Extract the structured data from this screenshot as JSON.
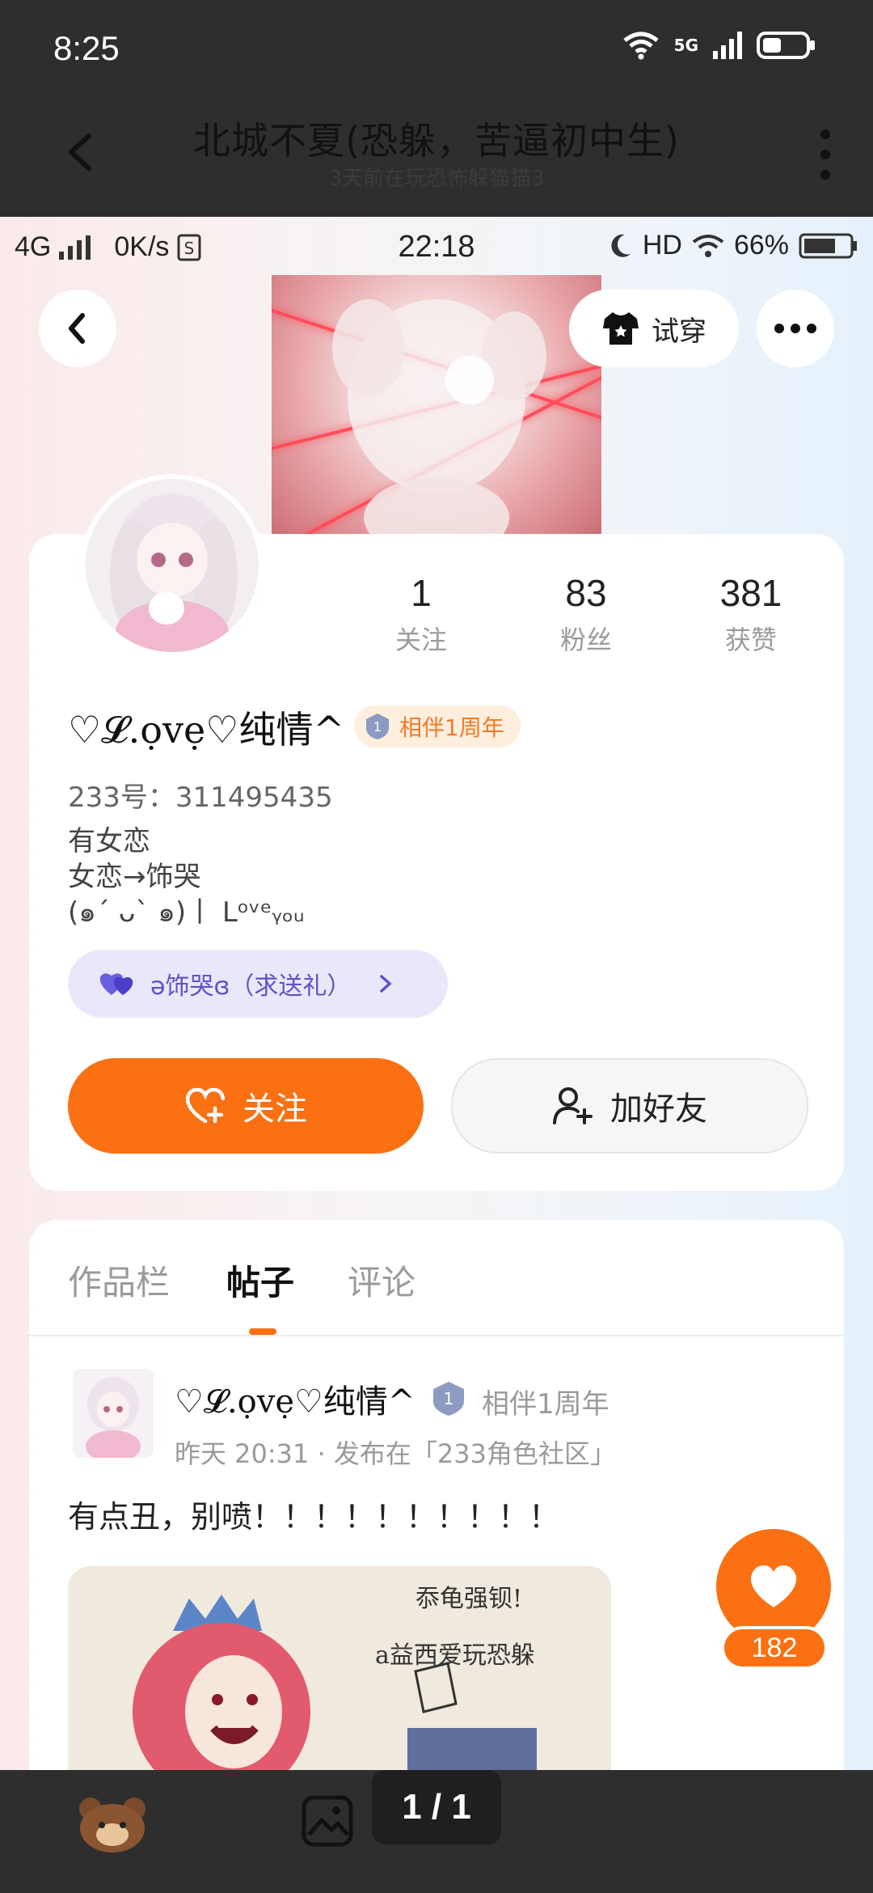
{
  "outer": {
    "time": "8:25",
    "network": "5G",
    "title": "北城不夏(恐躲，苦逼初中生)",
    "subtitle": "3天前在玩恐怖躲猫猫3",
    "pager": "1 / 1"
  },
  "inner_status": {
    "network": "4G",
    "speed": "0K/s",
    "time": "22:18",
    "hd": "HD",
    "battery": "66%"
  },
  "profile": {
    "tryon_label": "试穿",
    "stats": [
      {
        "value": "1",
        "label": "关注"
      },
      {
        "value": "83",
        "label": "粉丝"
      },
      {
        "value": "381",
        "label": "获赞"
      }
    ],
    "name": "♡𝓛.ọvẹ♡纯情^",
    "badge": "相伴1周年",
    "uid": "233号：311495435",
    "bio_lines": [
      "有女恋",
      "女恋→饰哭",
      "(๑ˊ ᴗˋ ๑)丨 Lᵒᵛᵉᵧₒᵤ"
    ],
    "gift_label": "ə饰哭ɞ（求送礼）",
    "follow_label": "关注",
    "add_friend_label": "加好友"
  },
  "tabs": [
    {
      "label": "作品栏",
      "active": false
    },
    {
      "label": "帖子",
      "active": true
    },
    {
      "label": "评论",
      "active": false
    }
  ],
  "post": {
    "author": "♡𝓛.ọvẹ♡纯情^",
    "badge": "相伴1周年",
    "meta": "昨天 20:31 · 发布在「233角色社区」",
    "text": "有点丑，别喷！！！！！！！！！！",
    "image_caption_1": "忝龟强钡!",
    "image_caption_2": "a益西爱玩恐躲",
    "like_count": "182"
  },
  "colors": {
    "accent": "#fa7012",
    "badge_bg": "#fdeede",
    "gift_bg": "#e9e8fb",
    "gift_text": "#5b53c6"
  }
}
